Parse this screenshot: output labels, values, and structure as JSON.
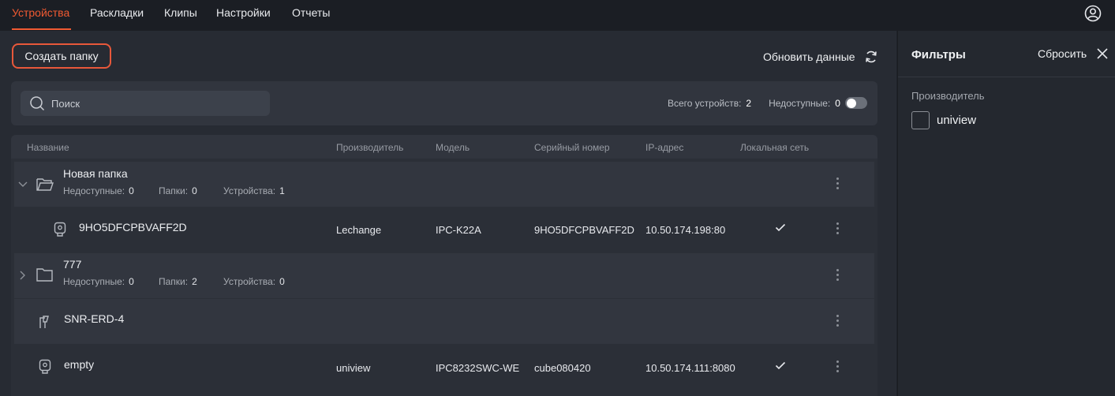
{
  "nav": {
    "tabs": [
      "Устройства",
      "Раскладки",
      "Клипы",
      "Настройки",
      "Отчеты"
    ],
    "active_tab": "Устройства",
    "accent": "#f05a32"
  },
  "toolbar": {
    "create_folder": "Создать папку",
    "refresh": "Обновить данные"
  },
  "search": {
    "placeholder": "Поиск"
  },
  "stats": {
    "total_label": "Всего устройств:",
    "total_value": "2",
    "unavailable_label": "Недоступные:",
    "unavailable_value": "0"
  },
  "table": {
    "headers": [
      "Название",
      "Производитель",
      "Модель",
      "Серийный номер",
      "IP-адрес",
      "Локальная сеть"
    ],
    "rows": [
      {
        "type": "folder",
        "expanded": true,
        "name": "Новая папка",
        "unavailable_label": "Недоступные:",
        "unavailable": "0",
        "folders_label": "Папки:",
        "folders": "0",
        "devices_label": "Устройства:",
        "devices": "1"
      },
      {
        "type": "camera",
        "name": "9HO5DFCPBVAFF2D",
        "manufacturer": "Lechange",
        "model": "IPC-K22A",
        "serial": "9HO5DFCPBVAFF2D",
        "ip": "10.50.174.198:80",
        "local": true
      },
      {
        "type": "folder",
        "expanded": false,
        "name": "777",
        "unavailable_label": "Недоступные:",
        "unavailable": "0",
        "folders_label": "Папки:",
        "folders": "2",
        "devices_label": "Устройства:",
        "devices": "0"
      },
      {
        "type": "sensor",
        "name": "SNR-ERD-4"
      },
      {
        "type": "camera",
        "name": "empty",
        "manufacturer": "uniview",
        "model": "IPC8232SWC-WE",
        "serial": "cube080420",
        "ip": "10.50.174.111:8080",
        "local": true
      }
    ]
  },
  "filters": {
    "title": "Фильтры",
    "reset": "Сбросить",
    "manufacturer_label": "Производитель",
    "options": [
      "uniview"
    ]
  }
}
